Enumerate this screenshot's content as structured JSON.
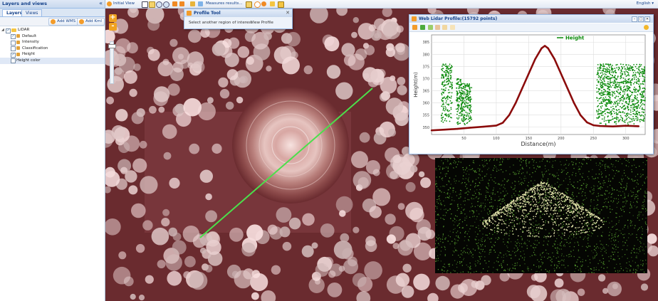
{
  "left_panel": {
    "title": "Layers and views",
    "collapse_glyph": "«",
    "tabs": [
      {
        "label": "Layers",
        "active": true
      },
      {
        "label": "Views",
        "active": false
      }
    ],
    "buttons": {
      "add_wms": "Add WMS",
      "add_kml": "Add Kml"
    },
    "tree": {
      "root": {
        "label": "LiDAR",
        "checked": true,
        "expanded": true
      },
      "children": [
        {
          "label": "Default",
          "checked": true
        },
        {
          "label": "Intensity",
          "checked": false
        },
        {
          "label": "Classification",
          "checked": false
        },
        {
          "label": "Height",
          "checked": true
        },
        {
          "label": "Height color",
          "checked": false,
          "selected": true
        }
      ]
    }
  },
  "toolbar": {
    "initial_view": "Initial View",
    "measures": "Measures results...",
    "language": "English ▾"
  },
  "map": {
    "zoom_in": "+",
    "zoom_out": "-",
    "profile_line_color": "#4be04b"
  },
  "profile_tool": {
    "title": "Profile Tool",
    "close_glyph": "✕",
    "select_region": "Select another region of interest",
    "view_profile": "View Profile"
  },
  "lidar_window": {
    "title": "Web Lidar Profile:(15792 points)",
    "controls": {
      "minimize": "–",
      "restore": "□",
      "close": "✕"
    }
  },
  "chart_data": {
    "type": "scatter",
    "xlabel": "Distance(m)",
    "ylabel": "Height(m)",
    "xlim": [
      0,
      330
    ],
    "ylim": [
      347,
      388
    ],
    "x_ticks": [
      50,
      100,
      150,
      200,
      250,
      300
    ],
    "y_ticks": [
      350,
      355,
      360,
      365,
      370,
      375,
      380,
      385
    ],
    "grid": true,
    "legend": "top-right",
    "series": [
      {
        "name": "Height",
        "color": "#0a8a0a",
        "profile_color": "#8b0b0b",
        "profile": [
          [
            0,
            348.7
          ],
          [
            20,
            349.0
          ],
          [
            40,
            349.3
          ],
          [
            60,
            349.8
          ],
          [
            80,
            350.2
          ],
          [
            100,
            350.7
          ],
          [
            110,
            351.8
          ],
          [
            120,
            355.0
          ],
          [
            130,
            360.0
          ],
          [
            140,
            366.0
          ],
          [
            150,
            372.0
          ],
          [
            160,
            378.0
          ],
          [
            170,
            382.5
          ],
          [
            175,
            383.5
          ],
          [
            180,
            382.5
          ],
          [
            190,
            378.0
          ],
          [
            200,
            372.0
          ],
          [
            210,
            366.0
          ],
          [
            220,
            360.0
          ],
          [
            230,
            355.0
          ],
          [
            240,
            352.0
          ],
          [
            250,
            350.8
          ],
          [
            260,
            350.5
          ],
          [
            280,
            350.3
          ],
          [
            300,
            350.6
          ],
          [
            320,
            350.4
          ]
        ],
        "vegetation_clusters": [
          {
            "x": [
              15,
              32
            ],
            "y": [
              352,
              376
            ]
          },
          {
            "x": [
              38,
              46
            ],
            "y": [
              351,
              370
            ]
          },
          {
            "x": [
              46,
              62
            ],
            "y": [
              351,
              368
            ]
          },
          {
            "x": [
              255,
              335
            ],
            "y": [
              351,
              376
            ]
          }
        ]
      }
    ]
  }
}
